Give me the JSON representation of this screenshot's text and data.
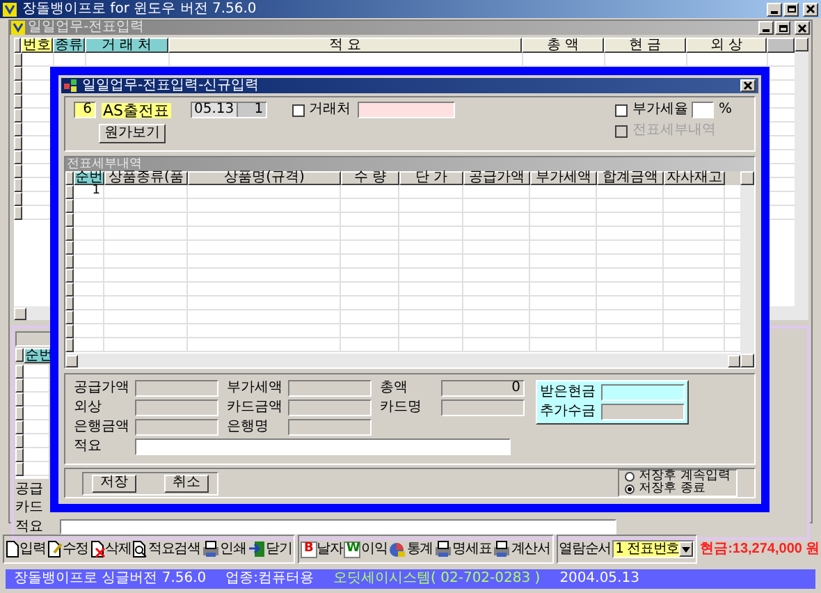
{
  "window": {
    "title": "장돌뱅이프로 for 윈도우 버전 7.56.0"
  },
  "child_window": {
    "title": "일일업무-전표입력"
  },
  "main_table": {
    "columns": [
      {
        "label": "번호",
        "color": "#ffff80"
      },
      {
        "label": "종류",
        "color": "#80d0d0"
      },
      {
        "label": "거 래 처",
        "color": "#80d0d0"
      },
      {
        "label": "적 요",
        "color": "#ece9d8"
      },
      {
        "label": "총 액",
        "color": "#ece9d8"
      },
      {
        "label": "현 금",
        "color": "#ece9d8"
      },
      {
        "label": "외 상",
        "color": "#ece9d8"
      }
    ]
  },
  "lower_panel": {
    "column": "순번",
    "labels": [
      "공급",
      "카드",
      "적요"
    ]
  },
  "dialog": {
    "title": "일일업무-전표입력-신규입력",
    "voucher_number": "6",
    "voucher_type": "AS출전표",
    "date": "05.13",
    "sequence": "1",
    "partner": {
      "label": "거래처",
      "checked": false
    },
    "cost_button": "원가보기",
    "vat_rate": {
      "label": "부가세율",
      "checked": false,
      "unit": "%"
    },
    "detail_option": {
      "label": "전표세부내역",
      "checked": false,
      "disabled": true
    },
    "detail": {
      "title": "전표세부내역",
      "columns": [
        {
          "label": "순번",
          "selected": true
        },
        {
          "label": "상품종류(품",
          "selected": false
        },
        {
          "label": "상품명(규격)",
          "selected": false
        },
        {
          "label": "수 량",
          "selected": false
        },
        {
          "label": "단 가",
          "selected": false
        },
        {
          "label": "공급가액",
          "selected": false
        },
        {
          "label": "부가세액",
          "selected": false
        },
        {
          "label": "합계금액",
          "selected": false
        },
        {
          "label": "자사재고",
          "selected": false
        }
      ],
      "rows": [
        [
          "1"
        ]
      ]
    },
    "summary": [
      [
        {
          "label": "공급가액"
        },
        {
          "label": "부가세액"
        },
        {
          "label": "총액",
          "value": "0"
        }
      ],
      [
        {
          "label": "외상"
        },
        {
          "label": "카드금액"
        },
        {
          "label": "카드명"
        }
      ],
      [
        {
          "label": "은행금액"
        },
        {
          "label": "은행명"
        }
      ]
    ],
    "cash": [
      {
        "label": "받은현금",
        "highlight": true
      },
      {
        "label": "추가수금",
        "highlight": false
      }
    ],
    "memo": {
      "label": "적요"
    },
    "buttons": [
      "저장",
      "취소"
    ],
    "after_save": [
      {
        "label": "저장후 계속입력",
        "selected": false
      },
      {
        "label": "저장후 종료",
        "selected": true
      }
    ]
  },
  "toolbar": [
    {
      "label": "입력"
    },
    {
      "label": "수정"
    },
    {
      "label": "삭제"
    },
    {
      "label": "적요검색"
    },
    {
      "label": "인쇄"
    },
    {
      "label": "닫기"
    }
  ],
  "toolbar2": [
    {
      "label": "날자",
      "icon_text": "B"
    },
    {
      "label": "이익",
      "icon_text": "W"
    },
    {
      "label": "통계"
    },
    {
      "label": "명세표"
    },
    {
      "label": "계산서"
    }
  ],
  "sort": {
    "label": "열람순서",
    "value": "1 전표번호"
  },
  "cash_total": "현금:13,274,000 원",
  "status_bar": [
    "장돌뱅이프로 싱글버전 7.56.0",
    "업종:컴퓨터용",
    "오딧세이시스템( 02-702-0283 )",
    "2004.05.13"
  ]
}
